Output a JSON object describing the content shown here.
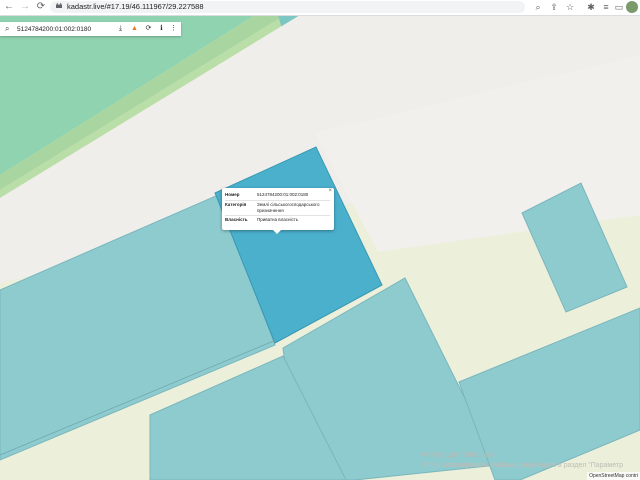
{
  "browser": {
    "url": "kadastr.live/#17.19/46.111967/29.227588",
    "back_icon": "arrow-left-icon",
    "forward_icon": "arrow-right-icon",
    "reload_icon": "reload-icon"
  },
  "search": {
    "query": "5124784200:01:002:0180"
  },
  "popup": {
    "rows": [
      {
        "label": "Номер",
        "value": "5124784200:01:002:0180"
      },
      {
        "label": "Категорія",
        "value": "Землі сільськогосподарського призначення"
      },
      {
        "label": "Власність",
        "value": "Приватна власність"
      }
    ],
    "close": "×"
  },
  "watermark": {
    "title": "Активация Windows",
    "subtitle": "Чтобы активировать Windows, перейдите в раздел \"Параметр"
  },
  "attribution": "OpenStreetMap contri",
  "colors": {
    "parcel_blue": "#8ecbcf",
    "selected_parcel": "#4ab0cc",
    "green": "#8fd3b0",
    "road": "#f0eeea",
    "background": "#ecefd9"
  }
}
